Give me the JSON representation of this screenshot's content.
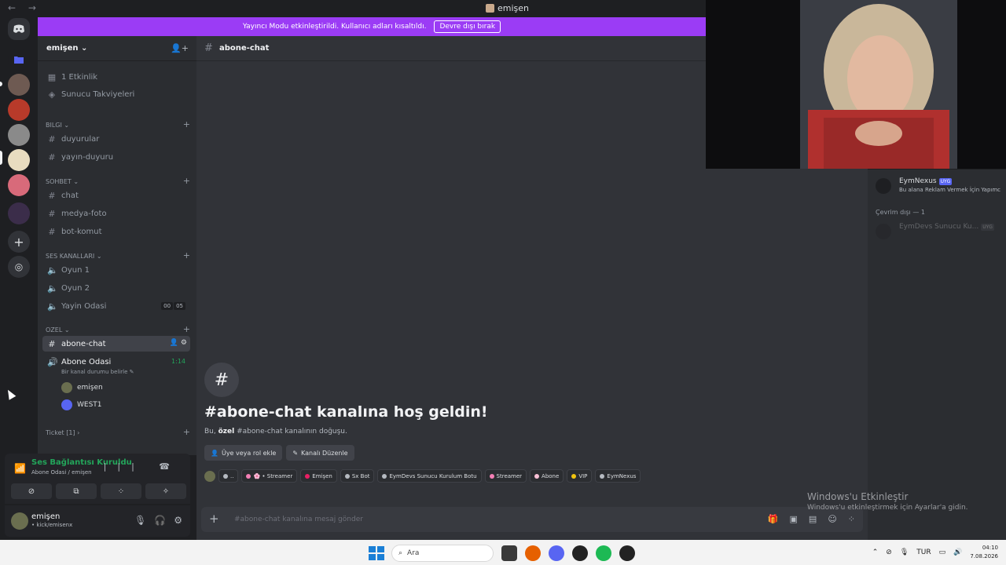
{
  "window": {
    "title": "emişen",
    "nav": "← →"
  },
  "banner": {
    "text": "Yayıncı Modu etkinleştirildi. Kullanıcı adları kısaltıldı.",
    "button": "Devre dışı bırak"
  },
  "server": {
    "name": "emişen ⌄"
  },
  "top_items": [
    {
      "icon": "calendar-icon",
      "label": "1 Etkinlik"
    },
    {
      "icon": "boost-icon",
      "label": "Sunucu Takviyeleri"
    }
  ],
  "categories": {
    "bilgi": "BILGI ⌄",
    "sohbet": "SOHBET ⌄",
    "ses": "SES KANALLARI ⌄",
    "ozel": "OZEL ⌄",
    "ticket": "Ticket [1] ›"
  },
  "channels": {
    "duyurular": "duyurular",
    "yayin_duyuru": "yayın-duyuru",
    "chat": "chat",
    "medya_foto": "medya-foto",
    "bot_komut": "bot-komut",
    "oyun1": "Oyun 1",
    "oyun2": "Oyun 2",
    "yayin_odasi": "Yayin Odasi",
    "yayin_odasi_counts": [
      "00",
      "05"
    ],
    "abone_chat": "abone-chat",
    "abone_odasi": "Abone Odasi",
    "abone_odasi_time": "1:14",
    "abone_odasi_status": "Bir kanal durumu belirle ✎"
  },
  "voice_users": [
    {
      "name": "emişen"
    },
    {
      "name": "WEST1"
    }
  ],
  "voice_panel": {
    "status": "Ses Bağlantısı Kuruldu",
    "sub": "Abone Odasi / emişen",
    "right_icons": "||| ☎"
  },
  "user_panel": {
    "name": "emişen",
    "status": "• kick/emisenx"
  },
  "chat": {
    "header_channel": "abone-chat",
    "welcome_title": "#abone-chat kanalına hoş geldin!",
    "welcome_sub_prefix": "Bu, ",
    "welcome_sub_bold": "özel",
    "welcome_sub_suffix": " #abone-chat kanalının doğuşu.",
    "add_button": "Üye veya rol ekle",
    "edit_button": "Kanalı Düzenle",
    "composer_placeholder": "#abone-chat kanalına mesaj gönder"
  },
  "roles": [
    {
      "label": "..",
      "color": "#b5bac1"
    },
    {
      "label": "🌸 • Streamer",
      "color": "#f47fb5"
    },
    {
      "label": "Emişen",
      "color": "#e91e63"
    },
    {
      "label": "Sx Bot",
      "color": "#b5bac1"
    },
    {
      "label": "EymDevs Sunucu Kurulum Botu",
      "color": "#b5bac1"
    },
    {
      "label": "Streamer",
      "color": "#f47fb5"
    },
    {
      "label": "Abone",
      "color": "#f9c0d6"
    },
    {
      "label": "VIP",
      "color": "#f1c40f"
    },
    {
      "label": "EymNexus",
      "color": "#b5bac1"
    }
  ],
  "members": {
    "online": {
      "name": "EymNexus",
      "tag": "UYG",
      "status": "Bu alana Reklam Vermek İçin Yapımc"
    },
    "offline_header": "Çevrim dışı — 1",
    "offline": {
      "name": "EymDevs Sunucu Ku...",
      "tag": "UYG"
    }
  },
  "windows_activation": {
    "title": "Windows'u Etkinleştir",
    "sub": "Windows'u etkinleştirmek için Ayarlar'a gidin."
  },
  "taskbar": {
    "search": "Ara",
    "lang": "TUR",
    "time": "04:10",
    "date": "7.08.2026"
  },
  "colors": {
    "banner": "#9b3cf5",
    "connected": "#23a55a",
    "brand": "#5865f2"
  }
}
